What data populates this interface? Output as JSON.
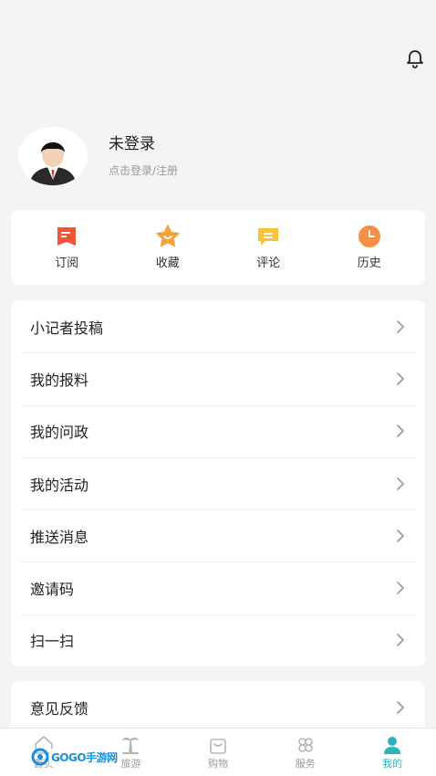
{
  "header": {
    "notification_icon": "bell-icon"
  },
  "profile": {
    "avatar_icon": "user-avatar",
    "name": "未登录",
    "hint": "点击登录/注册"
  },
  "quick_actions": [
    {
      "label": "订阅",
      "icon": "subscribe-icon",
      "color": "#f0553a"
    },
    {
      "label": "收藏",
      "icon": "star-icon",
      "color": "#f8a23a"
    },
    {
      "label": "评论",
      "icon": "comment-icon",
      "color": "#f8c33a"
    },
    {
      "label": "历史",
      "icon": "clock-icon",
      "color": "#f5833a"
    }
  ],
  "menu": [
    {
      "label": "小记者投稿"
    },
    {
      "label": "我的报料"
    },
    {
      "label": "我的问政"
    },
    {
      "label": "我的活动"
    },
    {
      "label": "推送消息"
    },
    {
      "label": "邀请码"
    },
    {
      "label": "扫一扫"
    }
  ],
  "menu2": [
    {
      "label": "意见反馈"
    }
  ],
  "tabbar": [
    {
      "label": "首页",
      "icon": "home-icon"
    },
    {
      "label": "旅游",
      "icon": "palm-tree-icon"
    },
    {
      "label": "购物",
      "icon": "shopping-bag-icon"
    },
    {
      "label": "服务",
      "icon": "service-icon"
    },
    {
      "label": "我的",
      "icon": "user-icon",
      "active": true
    }
  ],
  "watermark": "GOGO手游网",
  "colors": {
    "accent": "#2cb3bb",
    "background": "#f4f4f4"
  }
}
